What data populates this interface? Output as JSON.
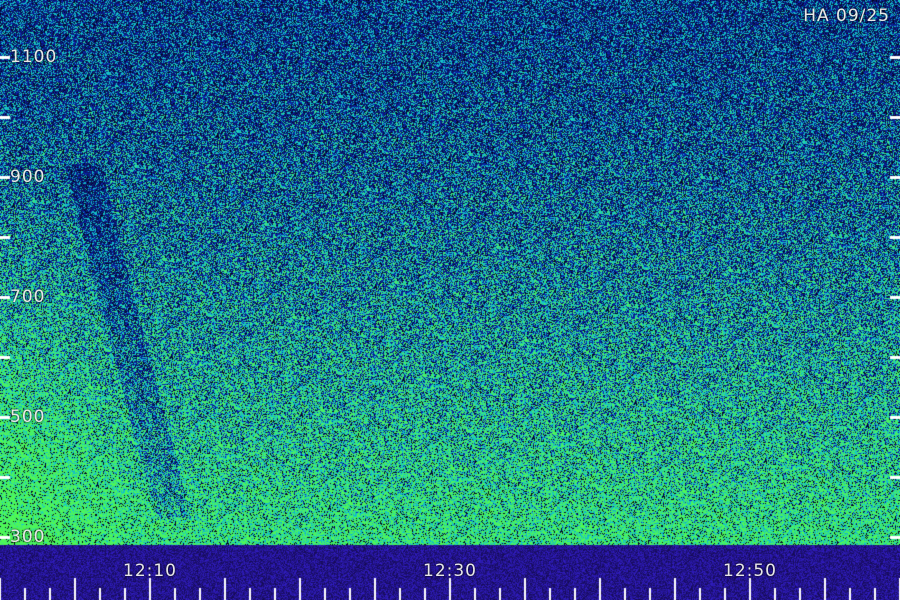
{
  "title": "HA 09/25",
  "colors": {
    "background_dark": "#050a3a",
    "noise_blue": "#1a3cff",
    "noise_cyan": "#1ac8d8",
    "noise_green": "#30e870",
    "tick": "#ffffff",
    "text": "#e8e8e8"
  },
  "y_axis": {
    "labels": [
      "1100",
      "900",
      "700",
      "500",
      "300"
    ],
    "values": [
      1100,
      900,
      700,
      500,
      300
    ],
    "range": [
      300,
      1100
    ]
  },
  "x_axis": {
    "labels": [
      "12:10",
      "12:30",
      "12:50"
    ]
  }
}
